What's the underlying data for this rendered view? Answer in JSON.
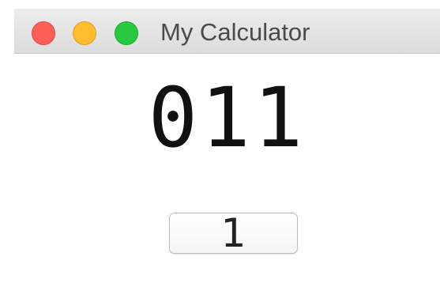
{
  "window": {
    "title": "My Calculator",
    "controls": {
      "close_color": "#ff5f57",
      "minimize_color": "#ffbd2e",
      "zoom_color": "#28c940"
    }
  },
  "display": {
    "value": "011"
  },
  "keypad": {
    "button_label": "1"
  }
}
